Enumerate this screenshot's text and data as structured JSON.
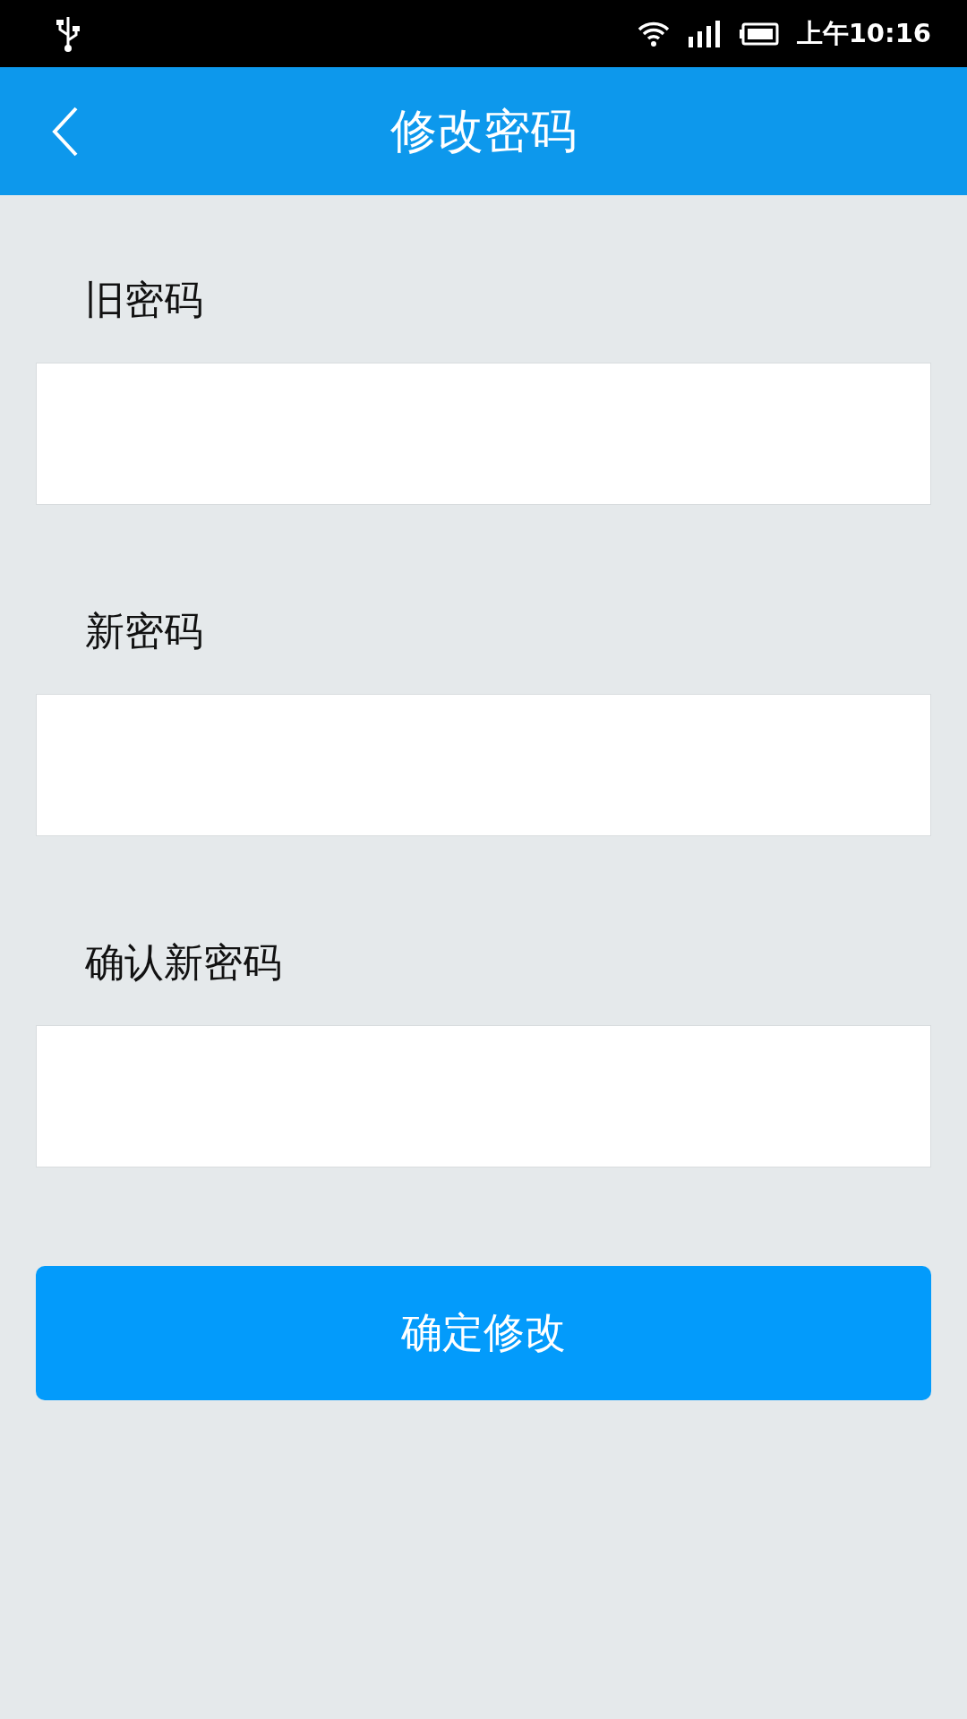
{
  "status_bar": {
    "time": "上午10:16"
  },
  "header": {
    "title": "修改密码"
  },
  "fields": [
    {
      "label": "旧密码"
    },
    {
      "label": "新密码"
    },
    {
      "label": "确认新密码"
    }
  ],
  "submit_button": {
    "label": "确定修改"
  }
}
